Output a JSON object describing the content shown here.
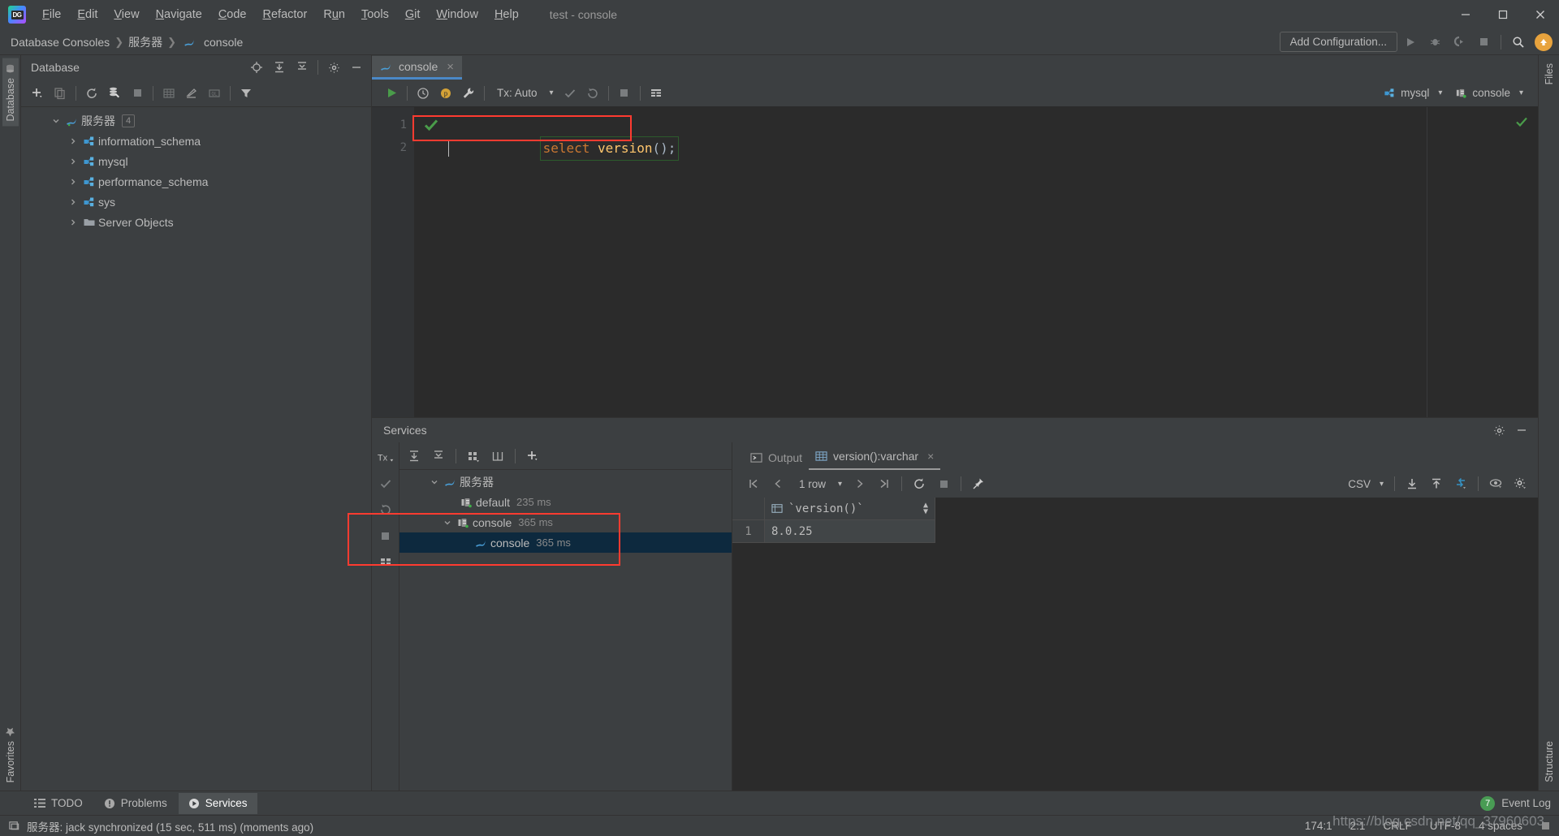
{
  "window": {
    "title": "test - console",
    "controls": [
      "minimize",
      "maximize",
      "close"
    ]
  },
  "menubar": {
    "logo": "datagrip-logo",
    "items": [
      {
        "label": "File",
        "mnemonic": "F"
      },
      {
        "label": "Edit",
        "mnemonic": "E"
      },
      {
        "label": "View",
        "mnemonic": "V"
      },
      {
        "label": "Navigate",
        "mnemonic": "N"
      },
      {
        "label": "Code",
        "mnemonic": "C"
      },
      {
        "label": "Refactor",
        "mnemonic": "R"
      },
      {
        "label": "Run",
        "mnemonic": "u"
      },
      {
        "label": "Tools",
        "mnemonic": "T"
      },
      {
        "label": "Git",
        "mnemonic": "G"
      },
      {
        "label": "Window",
        "mnemonic": "W"
      },
      {
        "label": "Help",
        "mnemonic": "H"
      }
    ]
  },
  "navbar": {
    "breadcrumb": [
      "Database Consoles",
      "服务器",
      "console"
    ],
    "add_configuration": "Add Configuration...",
    "icons": [
      "run-icon",
      "debug-icon",
      "run-with-coverage-icon",
      "stop-icon",
      "search-icon",
      "update-badge-icon"
    ]
  },
  "left_stripe": {
    "top_tab": "Database",
    "bottom_tab": "Favorites"
  },
  "right_stripe": {
    "top_tab": "Files",
    "bottom_tab": "Structure"
  },
  "database_panel": {
    "title": "Database",
    "header_icons": [
      "locate-icon",
      "expand-all-icon",
      "collapse-all-icon",
      "settings-icon",
      "hide-icon"
    ],
    "toolbar_icons": [
      "add-icon",
      "duplicate-icon",
      "refresh-icon",
      "data-source-properties-icon",
      "stop-icon",
      "table-icon",
      "modify-icon",
      "ql-console-icon",
      "filter-icon"
    ],
    "tree": [
      {
        "label": "服务器",
        "icon": "mysql-icon",
        "badge": "4",
        "expanded": true,
        "depth": 0
      },
      {
        "label": "information_schema",
        "icon": "schema-icon",
        "expanded": false,
        "depth": 1
      },
      {
        "label": "mysql",
        "icon": "schema-icon",
        "expanded": false,
        "depth": 1
      },
      {
        "label": "performance_schema",
        "icon": "schema-icon",
        "expanded": false,
        "depth": 1
      },
      {
        "label": "sys",
        "icon": "schema-icon",
        "expanded": false,
        "depth": 1
      },
      {
        "label": "Server Objects",
        "icon": "folder-icon",
        "expanded": false,
        "depth": 1
      }
    ]
  },
  "editor": {
    "tab": {
      "label": "console",
      "icon": "mysql-icon",
      "close": "×"
    },
    "toolbar": {
      "execute": "run-icon",
      "history": "history-icon",
      "parameters": "parameters-icon",
      "settings": "wrench-icon",
      "tx_label": "Tx: Auto",
      "commit": "commit-icon",
      "rollback": "rollback-icon",
      "stop": "stop-icon",
      "output_format": "output-icon",
      "schema_chip": "mysql",
      "session_chip": "console"
    },
    "lines": [
      {
        "number": "1",
        "status": "ok",
        "text": "select version();"
      },
      {
        "number": "2",
        "status": "",
        "text": ""
      }
    ],
    "code_tokens": {
      "keyword": "select",
      "space": " ",
      "function": "version",
      "punct": "();"
    },
    "inspection_status": "ok"
  },
  "services": {
    "title": "Services",
    "rail_icons": [
      "tx-icon",
      "commit-icon",
      "rollback-icon",
      "stop-icon",
      "grid-icon"
    ],
    "toolbar_icons": [
      "expand-all-icon",
      "collapse-all-icon",
      "group-by-icon",
      "add-tab-icon",
      "add-icon"
    ],
    "tree": [
      {
        "label": "服务器",
        "icon": "mysql-icon",
        "time": "",
        "depth": 0,
        "expanded": true,
        "selected": false
      },
      {
        "label": "default",
        "icon": "session-icon",
        "time": "235 ms",
        "depth": 1,
        "expanded": null,
        "selected": false
      },
      {
        "label": "console",
        "icon": "session-icon",
        "time": "365 ms",
        "depth": 1,
        "expanded": true,
        "selected": false
      },
      {
        "label": "console",
        "icon": "mysql-icon",
        "time": "365 ms",
        "depth": 2,
        "expanded": null,
        "selected": true
      }
    ],
    "result_tabs": [
      {
        "label": "Output",
        "icon": "console-output-icon",
        "active": false,
        "closable": false
      },
      {
        "label": "version():varchar",
        "icon": "grid-icon",
        "active": true,
        "closable": true
      }
    ],
    "result_toolbar": {
      "first": "first-row-icon",
      "prev": "prev-row-icon",
      "row_count": "1 row",
      "next": "next-row-icon",
      "last": "last-row-icon",
      "refresh": "refresh-icon",
      "stop": "stop-icon",
      "pin": "pin-icon",
      "format": "CSV",
      "download": "export-icon",
      "upload": "import-icon",
      "transpose": "transpose-icon",
      "view": "view-icon",
      "settings": "settings-icon"
    },
    "grid": {
      "columns": [
        "`version()`"
      ],
      "rows": [
        {
          "num": "1",
          "values": [
            "8.0.25"
          ]
        }
      ]
    }
  },
  "bottom_bar": {
    "tabs": [
      {
        "label": "TODO",
        "icon": "todo-icon",
        "active": false
      },
      {
        "label": "Problems",
        "icon": "problems-icon",
        "active": false
      },
      {
        "label": "Services",
        "icon": "services-icon",
        "active": true
      }
    ],
    "event_log": {
      "label": "Event Log",
      "count": "7"
    }
  },
  "status_bar": {
    "message": "服务器: jack synchronized (15 sec, 511 ms) (moments ago)",
    "icon": "memory-icon",
    "caret_position": "174:1",
    "selection": "2:1",
    "line_separator": "CRLF",
    "encoding": "UTF-8",
    "indent": "4 spaces"
  },
  "watermark": "https://blog.csdn.net/qq_37960603",
  "colors": {
    "background": "#3c3f41",
    "editor_background": "#2b2b2b",
    "accent_blue": "#4a88c7",
    "selection_blue": "#0d293e",
    "keyword_orange": "#cc7832",
    "function_yellow": "#ffc66d",
    "success_green": "#499c54",
    "annotation_red": "#ff3b30",
    "update_orange": "#e8a33d"
  }
}
